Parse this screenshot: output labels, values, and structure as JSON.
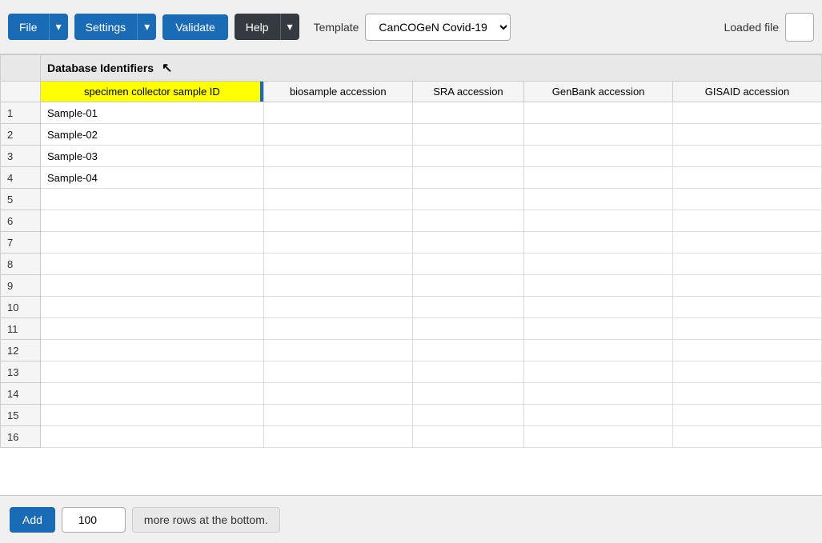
{
  "toolbar": {
    "file_label": "File",
    "settings_label": "Settings",
    "validate_label": "Validate",
    "help_label": "Help",
    "template_label": "Template",
    "template_value": "CanCOGeN Covid-19",
    "loaded_file_label": "Loaded file"
  },
  "sheet": {
    "group_header": "Database Identifiers",
    "columns": [
      "specimen collector sample ID",
      "biosample accession",
      "SRA accession",
      "GenBank accession",
      "GISAID accession"
    ],
    "rows": [
      {
        "num": 1,
        "values": [
          "Sample-01",
          "",
          "",
          "",
          ""
        ]
      },
      {
        "num": 2,
        "values": [
          "Sample-02",
          "",
          "",
          "",
          ""
        ]
      },
      {
        "num": 3,
        "values": [
          "Sample-03",
          "",
          "",
          "",
          ""
        ]
      },
      {
        "num": 4,
        "values": [
          "Sample-04",
          "",
          "",
          "",
          ""
        ]
      },
      {
        "num": 5,
        "values": [
          "",
          "",
          "",
          "",
          ""
        ]
      },
      {
        "num": 6,
        "values": [
          "",
          "",
          "",
          "",
          ""
        ]
      },
      {
        "num": 7,
        "values": [
          "",
          "",
          "",
          "",
          ""
        ]
      },
      {
        "num": 8,
        "values": [
          "",
          "",
          "",
          "",
          ""
        ]
      },
      {
        "num": 9,
        "values": [
          "",
          "",
          "",
          "",
          ""
        ]
      },
      {
        "num": 10,
        "values": [
          "",
          "",
          "",
          "",
          ""
        ]
      },
      {
        "num": 11,
        "values": [
          "",
          "",
          "",
          "",
          ""
        ]
      },
      {
        "num": 12,
        "values": [
          "",
          "",
          "",
          "",
          ""
        ]
      },
      {
        "num": 13,
        "values": [
          "",
          "",
          "",
          "",
          ""
        ]
      },
      {
        "num": 14,
        "values": [
          "",
          "",
          "",
          "",
          ""
        ]
      },
      {
        "num": 15,
        "values": [
          "",
          "",
          "",
          "",
          ""
        ]
      },
      {
        "num": 16,
        "values": [
          "",
          "",
          "",
          "",
          ""
        ]
      }
    ]
  },
  "bottom_bar": {
    "add_label": "Add",
    "rows_value": "100",
    "rows_suffix": "more rows at the bottom."
  }
}
